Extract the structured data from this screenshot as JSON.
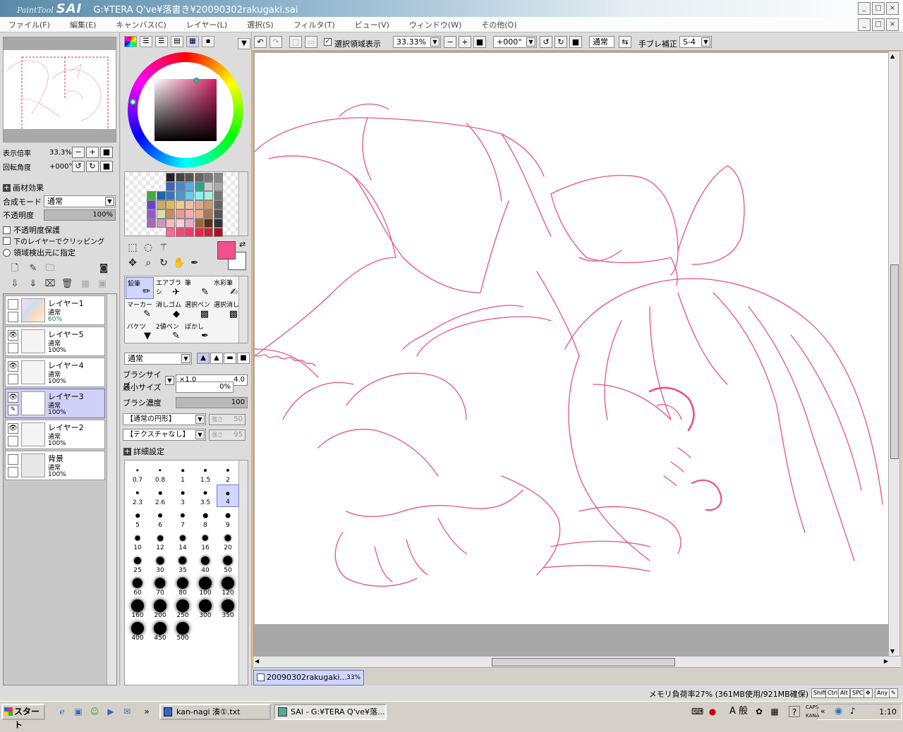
{
  "titlebar": {
    "logo_small": "PaintTool",
    "logo_big": "SAI",
    "path": "G:¥TERA Q've¥落書き¥20090302rakugaki.sai",
    "btn_min": "_",
    "btn_max": "□",
    "btn_close": "×"
  },
  "menu": [
    "ファイル(F)",
    "編集(E)",
    "キャンバス(C)",
    "レイヤー(L)",
    "選択(S)",
    "フィルタ(T)",
    "ビュー(V)",
    "ウィンドウ(W)",
    "その他(O)"
  ],
  "navigator": {
    "zoom_label": "表示倍率",
    "zoom_value": "33.3%",
    "rotate_label": "回転角度",
    "rotate_value": "+000°"
  },
  "layer_props": {
    "texture_label": "画材効果",
    "blend_label": "合成モード",
    "blend_value": "通常",
    "opacity_label": "不透明度",
    "opacity_value": "100%",
    "preserve_opacity": "不透明度保護",
    "clipping": "下のレイヤーでクリッピング",
    "selection_source": "領域検出元に指定"
  },
  "layers": [
    {
      "name": "レイヤー1",
      "mode": "通常",
      "opacity": "60%",
      "visible": false,
      "selected": false
    },
    {
      "name": "レイヤー5",
      "mode": "通常",
      "opacity": "100%",
      "visible": true,
      "selected": false
    },
    {
      "name": "レイヤー4",
      "mode": "通常",
      "opacity": "100%",
      "visible": true,
      "selected": false
    },
    {
      "name": "レイヤー3",
      "mode": "通常",
      "opacity": "100%",
      "visible": true,
      "selected": true
    },
    {
      "name": "レイヤー2",
      "mode": "通常",
      "opacity": "100%",
      "visible": true,
      "selected": false
    },
    {
      "name": "背景",
      "mode": "通常",
      "opacity": "100%",
      "visible": false,
      "selected": false
    }
  ],
  "colors": {
    "foreground": "#f0508c",
    "background": "#ffffff",
    "accent": "#e8a040",
    "line_art": "#e8508c",
    "selection": "#cfd6ff"
  },
  "brush_tools": [
    {
      "label": "鉛筆",
      "icon": "pencil-icon",
      "selected": true
    },
    {
      "label": "エアブラシ",
      "icon": "airbrush-icon",
      "selected": false
    },
    {
      "label": "筆",
      "icon": "brush-icon",
      "selected": false
    },
    {
      "label": "水彩筆",
      "icon": "watercolor-icon",
      "selected": false
    },
    {
      "label": "マーカー",
      "icon": "marker-icon",
      "selected": false
    },
    {
      "label": "消しゴム",
      "icon": "eraser-icon",
      "selected": false
    },
    {
      "label": "選択ペン",
      "icon": "select-pen-icon",
      "selected": false
    },
    {
      "label": "選択消し",
      "icon": "select-erase-icon",
      "selected": false
    },
    {
      "label": "バケツ",
      "icon": "bucket-icon",
      "selected": false
    },
    {
      "label": "2値ペン",
      "icon": "binary-pen-icon",
      "selected": false
    },
    {
      "label": "ぼかし",
      "icon": "blur-icon",
      "selected": false
    }
  ],
  "brush_settings": {
    "mode_value": "通常",
    "size_label": "ブラシサイズ",
    "size_multiplier": "×1.0",
    "size_value": "4.0",
    "min_size_label": "最小サイズ",
    "min_size_value": "0%",
    "density_label": "ブラシ濃度",
    "density_value": "100",
    "shape_value": "【通常の円形】",
    "shape_strength_label": "強さ",
    "shape_strength_value": "50",
    "texture_value": "【テクスチャなし】",
    "texture_strength_label": "強さ",
    "texture_strength_value": "95",
    "detail_label": "詳細設定"
  },
  "brush_sizes": [
    "0.7",
    "0.8",
    "1",
    "1.5",
    "2",
    "2.3",
    "2.6",
    "3",
    "3.5",
    "4",
    "5",
    "6",
    "7",
    "8",
    "9",
    "10",
    "12",
    "14",
    "16",
    "20",
    "25",
    "30",
    "35",
    "40",
    "50",
    "60",
    "70",
    "80",
    "100",
    "120",
    "160",
    "200",
    "250",
    "300",
    "350",
    "400",
    "450",
    "500"
  ],
  "selected_brush_size": "4",
  "canvas_toolbar": {
    "show_selection_label": "選択領域表示",
    "zoom": "33.33%",
    "rotation": "+000°",
    "blend": "通常",
    "stabilizer_label": "手ブレ補正",
    "stabilizer_value": "S-4"
  },
  "document_tab": {
    "name": "20090302rakugaki...",
    "zoom": "33%"
  },
  "status": {
    "memory": "メモリ負荷率27% (361MB使用/921MB確保)",
    "keys": [
      "Shift",
      "Ctrl",
      "Alt",
      "SPC",
      "Any"
    ]
  },
  "taskbar": {
    "start": "スタート",
    "items": [
      {
        "label": "kan-nagi 湊①.txt",
        "active": false
      },
      {
        "label": "SAI - G:¥TERA Q've¥落...",
        "active": true
      }
    ],
    "ime": "A 般",
    "caps": "CAPS",
    "kana": "KANA",
    "clock": "1:10"
  }
}
